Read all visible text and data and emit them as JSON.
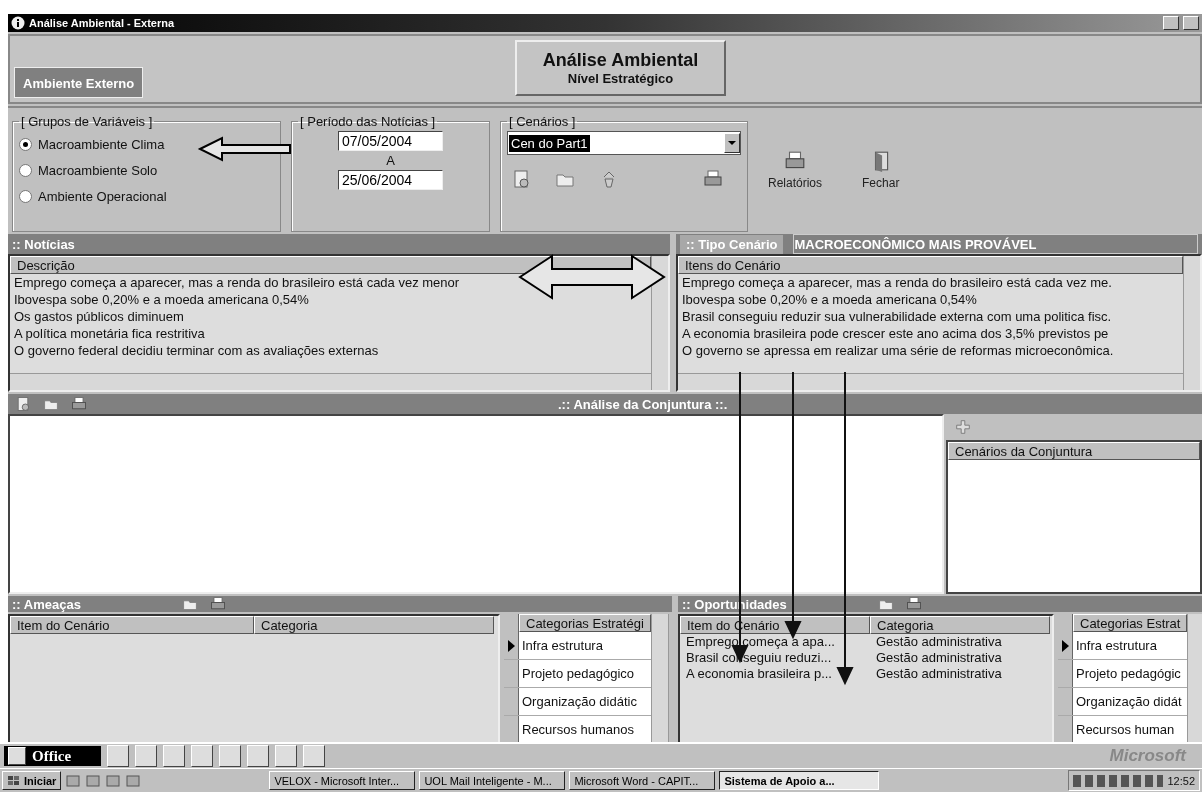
{
  "window": {
    "title": "Análise Ambiental - Externa"
  },
  "header": {
    "tab": "Ambiente Externo",
    "title": "Análise Ambiental",
    "subtitle": "Nível Estratégico"
  },
  "variable_groups": {
    "label": "[  Grupos de Variáveis  ]",
    "options": [
      {
        "label": "Macroambiente Clima",
        "selected": true
      },
      {
        "label": "Macroambiente Solo",
        "selected": false
      },
      {
        "label": "Ambiente Operacional",
        "selected": false
      }
    ]
  },
  "period": {
    "label": "[  Período das Notícias  ]",
    "start": "07/05/2004",
    "separator": "A",
    "end": "25/06/2004"
  },
  "scenarios": {
    "label": "[  Cenários  ]",
    "value": "Cen do Part1"
  },
  "actions": [
    {
      "label": "Relatórios",
      "kind": "printer"
    },
    {
      "label": "Fechar",
      "kind": "door"
    }
  ],
  "news": {
    "title": ":: Notícias",
    "column": "Descrição",
    "rows": [
      "Emprego começa a aparecer, mas a renda do brasileiro está cada vez menor",
      "Ibovespa sobe 0,20% e a moeda americana 0,54%",
      "Os gastos públicos diminuem",
      "A política monetária fica restritiva",
      "O governo federal decidiu terminar com as avaliações externas"
    ]
  },
  "scenario_type": {
    "label": ":: Tipo Cenário",
    "value": "MACROECONÔMICO MAIS PROVÁVEL",
    "column": "Itens do Cenário",
    "rows": [
      "Emprego começa a aparecer, mas a renda do brasileiro está cada vez me.",
      "Ibovespa sobe 0,20% e a moeda americana 0,54%",
      "Brasil conseguiu reduzir sua vulnerabilidade externa com uma politica fisc.",
      "A economia brasileira pode crescer este ano acima dos 3,5% previstos pe",
      "O governo se apressa em realizar uma série de reformas microeconômica."
    ]
  },
  "conjuntura": {
    "title": ".:: Análise da Conjuntura ::.",
    "side_column": "Cenários da Conjuntura"
  },
  "threats": {
    "title": ":: Ameaças",
    "columns": [
      "Item do Cenário",
      "Categoria"
    ],
    "category_column": "Categorias Estratégi",
    "categories": [
      {
        "label": "Infra estrutura",
        "selected": true
      },
      {
        "label": "Projeto pedagógico",
        "selected": false
      },
      {
        "label": "Organização didátic",
        "selected": false
      },
      {
        "label": "Recursos humanos",
        "selected": false
      }
    ]
  },
  "opportunities": {
    "title": ":: Oportunidades",
    "columns": [
      "Item do Cenário",
      "Categoria"
    ],
    "rows": [
      [
        "Emprego começa a apa...",
        "Gestão administrativa"
      ],
      [
        "Brasil conseguiu reduzi...",
        "Gestão administrativa"
      ],
      [
        "A economia brasileira p...",
        "Gestão administrativa"
      ]
    ],
    "category_column": "Categorias Estrat",
    "categories": [
      {
        "label": "Infra estrutura",
        "selected": true
      },
      {
        "label": "Projeto pedagógic",
        "selected": false
      },
      {
        "label": "Organização didát",
        "selected": false
      },
      {
        "label": "Recursos human",
        "selected": false
      }
    ]
  },
  "office_bar": {
    "label": "Office",
    "brand": "Microsoft"
  },
  "taskbar": {
    "start": "Iniciar",
    "tasks": [
      {
        "label": "VELOX - Microsoft Inter...",
        "selected": false
      },
      {
        "label": "UOL Mail Inteligente - M...",
        "selected": false
      },
      {
        "label": "Microsoft Word - CAPIT...",
        "selected": false
      },
      {
        "label": "Sistema de Apoio a...",
        "selected": true
      }
    ],
    "clock": "12:52"
  }
}
